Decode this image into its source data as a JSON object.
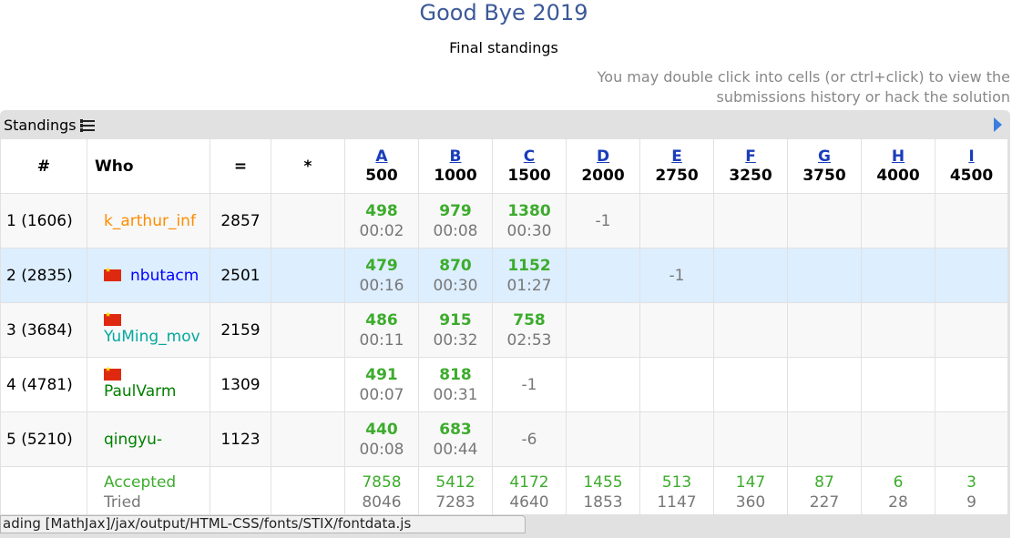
{
  "page": {
    "title": "Good Bye 2019",
    "subtitle": "Final standings",
    "hint": "You may double click into cells (or ctrl+click) to view the submissions history or hack the solution"
  },
  "panel": {
    "label": "Standings",
    "menu_icon": "menu-icon",
    "expand_icon": "triangle-right-icon"
  },
  "header": {
    "rank": "#",
    "who": "Who",
    "points": "=",
    "penalty": "*",
    "problems": [
      {
        "letter": "A",
        "points": "500"
      },
      {
        "letter": "B",
        "points": "1000"
      },
      {
        "letter": "C",
        "points": "1500"
      },
      {
        "letter": "D",
        "points": "2000"
      },
      {
        "letter": "E",
        "points": "2750"
      },
      {
        "letter": "F",
        "points": "3250"
      },
      {
        "letter": "G",
        "points": "3750"
      },
      {
        "letter": "H",
        "points": "4000"
      },
      {
        "letter": "I",
        "points": "4500"
      }
    ]
  },
  "rows": [
    {
      "rank": "1 (1606)",
      "handle": "k_arthur_inf",
      "handle_color": "#ff8c00",
      "flag": false,
      "points": "2857",
      "penalty": "",
      "cells": [
        {
          "score": "498",
          "time": "00:02"
        },
        {
          "score": "979",
          "time": "00:08"
        },
        {
          "score": "1380",
          "time": "00:30"
        },
        {
          "neg": "-1"
        },
        {},
        {},
        {},
        {},
        {}
      ]
    },
    {
      "rank": "2 (2835)",
      "handle": "nbutacm",
      "handle_color": "#0000ff",
      "flag": true,
      "flag_inline": true,
      "points": "2501",
      "penalty": "",
      "cells": [
        {
          "score": "479",
          "time": "00:16"
        },
        {
          "score": "870",
          "time": "00:30"
        },
        {
          "score": "1152",
          "time": "01:27"
        },
        {},
        {
          "neg": "-1"
        },
        {},
        {},
        {},
        {}
      ]
    },
    {
      "rank": "3 (3684)",
      "handle": "YuMing_mov",
      "handle_color": "#03a89e",
      "flag": true,
      "flag_inline": false,
      "points": "2159",
      "penalty": "",
      "cells": [
        {
          "score": "486",
          "time": "00:11"
        },
        {
          "score": "915",
          "time": "00:32"
        },
        {
          "score": "758",
          "time": "02:53"
        },
        {},
        {},
        {},
        {},
        {},
        {}
      ]
    },
    {
      "rank": "4 (4781)",
      "handle": "PaulVarm",
      "handle_color": "#008000",
      "flag": true,
      "flag_inline": false,
      "points": "1309",
      "penalty": "",
      "cells": [
        {
          "score": "491",
          "time": "00:07"
        },
        {
          "score": "818",
          "time": "00:31"
        },
        {
          "neg": "-1"
        },
        {},
        {},
        {},
        {},
        {},
        {}
      ]
    },
    {
      "rank": "5 (5210)",
      "handle": "qingyu-",
      "handle_color": "#008000",
      "flag": false,
      "points": "1123",
      "penalty": "",
      "cells": [
        {
          "score": "440",
          "time": "00:08"
        },
        {
          "score": "683",
          "time": "00:44"
        },
        {
          "neg": "-6"
        },
        {},
        {},
        {},
        {},
        {},
        {}
      ]
    }
  ],
  "stats": {
    "accepted_label": "Accepted",
    "tried_label": "Tried",
    "accepted": [
      "7858",
      "5412",
      "4172",
      "1455",
      "513",
      "147",
      "87",
      "6",
      "3"
    ],
    "tried": [
      "8046",
      "7283",
      "4640",
      "1853",
      "1147",
      "360",
      "227",
      "28",
      "9"
    ]
  },
  "status_bar": {
    "text": "ading [MathJax]/jax/output/HTML-CSS/fonts/STIX/fontdata.js"
  },
  "colors": {
    "title": "#3b5998",
    "accepted": "#3cac2c",
    "highlight_row": "#ddeeff",
    "problem_link": "#1a3dbb"
  }
}
